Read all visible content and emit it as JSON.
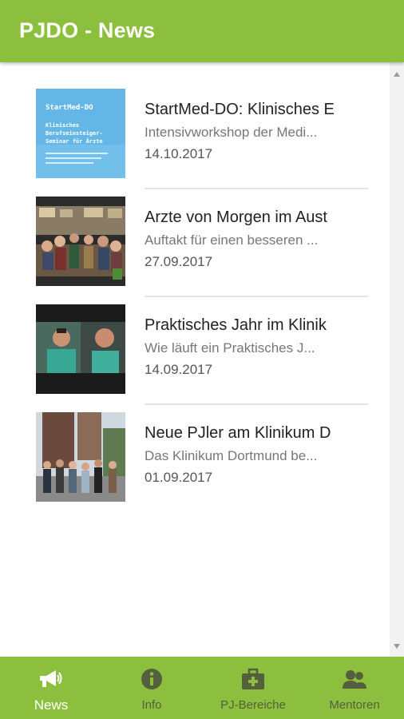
{
  "appbar": {
    "title": "PJDO - News"
  },
  "news": [
    {
      "title": "StartMed-DO: Klinisches E",
      "subtitle": "Intensivworkshop der Medi...",
      "date": "14.10.2017",
      "thumb": {
        "line1": "StartMed-DO",
        "line2": "Klinisches",
        "line3": "Berufseinsteiger-",
        "line4": "Seminar für Ärzte"
      }
    },
    {
      "title": "Arzte von Morgen im Aust",
      "subtitle": "Auftakt für einen besseren ...",
      "date": "27.09.2017"
    },
    {
      "title": "Praktisches Jahr im Klinik",
      "subtitle": "Wie läuft ein Praktisches J...",
      "date": "14.09.2017"
    },
    {
      "title": "Neue PJler am Klinikum D",
      "subtitle": "Das Klinikum Dortmund be...",
      "date": "01.09.2017"
    }
  ],
  "bottom_nav": [
    {
      "label": "News",
      "icon": "megaphone-icon",
      "active": true
    },
    {
      "label": "Info",
      "icon": "info-icon",
      "active": false
    },
    {
      "label": "PJ-Bereiche",
      "icon": "medical-kit-icon",
      "active": false
    },
    {
      "label": "Mentoren",
      "icon": "people-icon",
      "active": false
    }
  ],
  "colors": {
    "primary": "#8dbf3e",
    "inactive_nav": "#555f3e",
    "active_nav": "#ffffff"
  }
}
